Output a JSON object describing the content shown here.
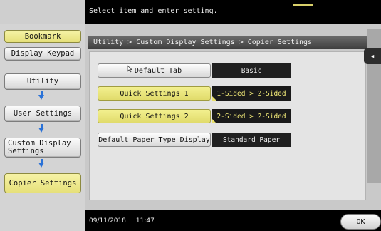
{
  "message": "Select item and enter setting.",
  "sidebar": {
    "bookmark": "Bookmark",
    "display_keypad": "Display Keypad",
    "utility": "Utility",
    "user_settings": "User Settings",
    "custom_display_settings": "Custom Display Settings",
    "copier_settings": "Copier Settings"
  },
  "breadcrumb": "Utility > Custom Display Settings > Copier Settings",
  "settings": {
    "default_tab": {
      "label": "Default Tab",
      "value": "Basic"
    },
    "quick_1": {
      "label": "Quick Settings 1",
      "value": "1-Sided > 2-Sided"
    },
    "quick_2": {
      "label": "Quick Settings 2",
      "value": "2-Sided > 2-Sided"
    },
    "paper_type": {
      "label": "Default Paper Type Display",
      "value": "Standard Paper"
    }
  },
  "back_arrow": "◂",
  "footer": {
    "date": "09/11/2018",
    "time": "11:47",
    "ok": "OK"
  },
  "icons": [
    "arrow-down-icon",
    "back-arrow-icon",
    "cursor-icon"
  ],
  "colors": {
    "accent_yellow": "#f4ec78",
    "arrow_blue": "#2a72d8"
  }
}
